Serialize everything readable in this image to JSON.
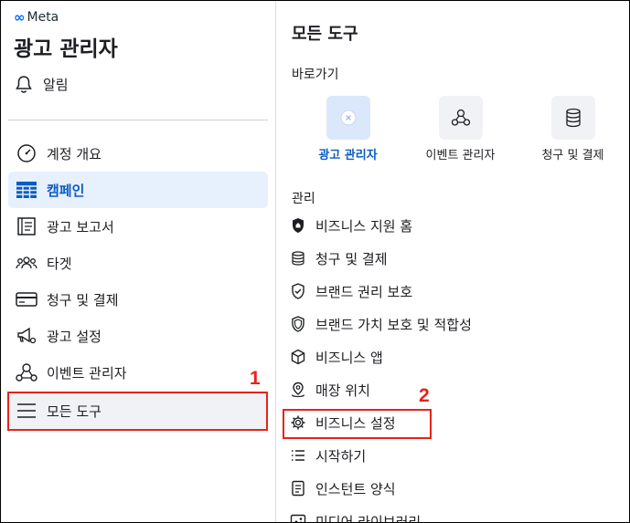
{
  "sidebar": {
    "brand": "Meta",
    "app_title": "광고 관리자",
    "notifications": "알림",
    "items": [
      {
        "label": "계정 개요"
      },
      {
        "label": "캠페인"
      },
      {
        "label": "광고 보고서"
      },
      {
        "label": "타겟"
      },
      {
        "label": "청구 및 결제"
      },
      {
        "label": "광고 설정"
      },
      {
        "label": "이벤트 관리자"
      },
      {
        "label": "모든 도구"
      }
    ]
  },
  "panel": {
    "title": "모든 도구",
    "shortcuts_heading": "바로가기",
    "shortcuts": [
      {
        "label": "광고 관리자"
      },
      {
        "label": "이벤트 관리자"
      },
      {
        "label": "청구 및 결제"
      }
    ],
    "manage_heading": "관리",
    "manage": [
      {
        "label": "비즈니스 지원 홈"
      },
      {
        "label": "청구 및 결제"
      },
      {
        "label": "브랜드 권리 보호"
      },
      {
        "label": "브랜드 가치 보호 및 적합성"
      },
      {
        "label": "비즈니스 앱"
      },
      {
        "label": "매장 위치"
      },
      {
        "label": "비즈니스 설정"
      },
      {
        "label": "시작하기"
      },
      {
        "label": "인스턴트 양식"
      },
      {
        "label": "미디어 라이브러리"
      }
    ]
  },
  "annotations": [
    "1",
    "2"
  ],
  "colors": {
    "accent": "#0a5dc2",
    "highlight": "#e5231b"
  }
}
